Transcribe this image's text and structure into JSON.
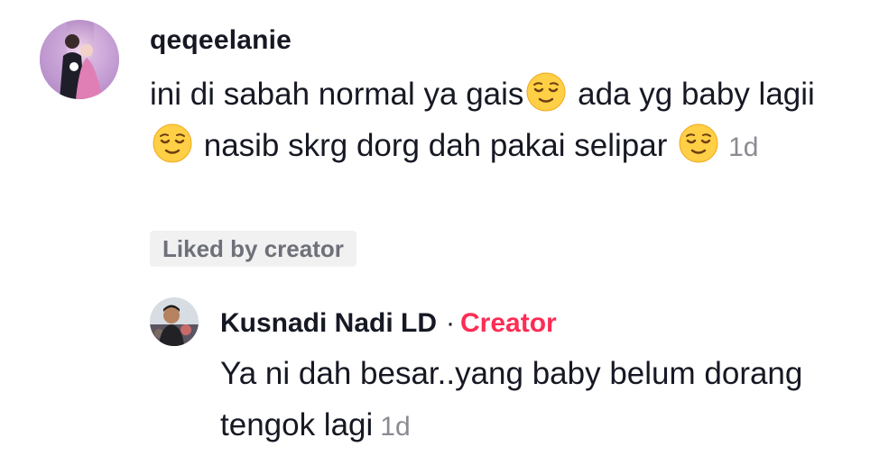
{
  "comment": {
    "username": "qeqeelanie",
    "text_parts": [
      "ini di sabah normal ya gais",
      " ada yg baby lagii ",
      " nasib skrg dorg dah pakai selipar "
    ],
    "emoji": "relieved-face-emoji",
    "time": "1d",
    "liked_badge": "Liked by creator"
  },
  "reply": {
    "username": "Kusnadi Nadi LD",
    "separator": "·",
    "creator_label": "Creator",
    "text": "Ya ni dah besar..yang baby belum dorang tengok lagi",
    "time": "1d"
  },
  "colors": {
    "text": "#161823",
    "muted": "#8a8b91",
    "creator": "#fe2c55",
    "badge_bg": "#f1f1f2"
  }
}
